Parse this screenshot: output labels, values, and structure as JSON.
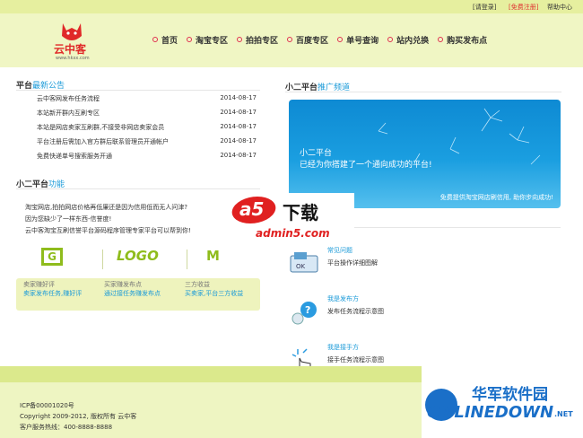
{
  "topbar": {
    "login": "[请登录]",
    "register": "[免费注册]",
    "help": "帮助中心"
  },
  "logo": {
    "name": "云中客",
    "url": "www.hkxx.com"
  },
  "nav": [
    {
      "label": "首页"
    },
    {
      "label": "淘宝专区"
    },
    {
      "label": "拍拍专区"
    },
    {
      "label": "百度专区"
    },
    {
      "label": "单号查询"
    },
    {
      "label": "站内兑换"
    },
    {
      "label": "购买发布点"
    }
  ],
  "announce": {
    "prefix": "平台",
    "title": "最新公告",
    "items": [
      {
        "text": "云中客网发布任务流程",
        "date": "2014-08-17"
      },
      {
        "text": "本站新开群内互刷专区",
        "date": "2014-08-17"
      },
      {
        "text": "本站是网店卖家互刷群,不接受非网店卖家会员",
        "date": "2014-08-17"
      },
      {
        "text": "平台注册后需加入官方群后联系管理员开通帐户",
        "date": "2014-08-17"
      },
      {
        "text": "免费快递单号搜索服务开通",
        "date": "2014-08-17"
      }
    ]
  },
  "promo_section": {
    "prefix": "小二平台",
    "title": "推广频道"
  },
  "promo": {
    "line1": "小二平台",
    "line2": "已经为你搭建了一个通向成功的平台!",
    "tagline": "免费提供淘宝网店刷信用, 助你步向成功!"
  },
  "features": {
    "prefix": "小二平台",
    "title": "功能",
    "lines": [
      "淘宝网店,拍拍网店价格再低廉还是因为信用低而无人问津?",
      "因为您缺少了一样东西-信誉度!",
      "云中客淘宝互刷信誉平台源码程序管理专家平台可以帮到你!"
    ],
    "logos": [
      "G",
      "LOGO",
      "M"
    ],
    "boxes": [
      {
        "title": "卖家赚好评",
        "sub": "卖家发布任务,赚好评"
      },
      {
        "title": "买家赚发布点",
        "sub": "通过接任务赚发布点"
      },
      {
        "title": "三方收益",
        "sub": "买卖家,平台三方收益"
      }
    ]
  },
  "watermark": {
    "text": "下载",
    "site": "admin5.com",
    "brand": "a5"
  },
  "help_items": [
    {
      "title": "常见问题",
      "desc": "平台操作详细图解"
    },
    {
      "title": "我是发布方",
      "desc": "发布任务流程示意图"
    },
    {
      "title": "我是接手方",
      "desc": "接手任务流程示意图"
    }
  ],
  "footer": {
    "icp": "ICP备00001020号",
    "copyright": "Copyright 2009-2012, 版权所有 云中客",
    "hotline": "客户服务热线：400-8888-8888"
  },
  "onlinedown": {
    "cn": "华军软件园",
    "en": "ONLINEDOWN",
    "suffix": ".NET"
  }
}
